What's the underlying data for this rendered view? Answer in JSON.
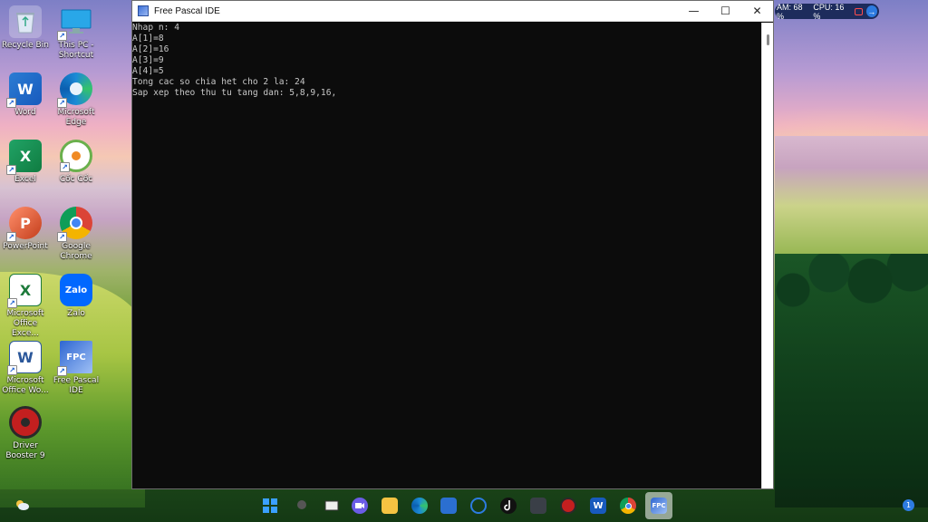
{
  "window": {
    "title": "Free Pascal IDE",
    "minimize_glyph": "—",
    "maximize_glyph": "☐",
    "close_glyph": "✕"
  },
  "console": {
    "lines": [
      "Nhap n: 4",
      "A[1]=8",
      "A[2]=16",
      "A[3]=9",
      "A[4]=5",
      "Tong cac so chia het cho 2 la: 24",
      "Sap xep theo thu tu tang dan: 5,8,9,16,"
    ]
  },
  "desktop": {
    "icons": [
      {
        "label": "Recycle Bin",
        "icon": "recycle-bin-icon"
      },
      {
        "label": "This PC - Shortcut",
        "icon": "monitor-icon"
      },
      {
        "label": "Word",
        "icon": "word-icon"
      },
      {
        "label": "Microsoft Edge",
        "icon": "edge-icon"
      },
      {
        "label": "Excel",
        "icon": "excel-icon"
      },
      {
        "label": "Cốc Cốc",
        "icon": "coccoc-icon"
      },
      {
        "label": "PowerPoint",
        "icon": "powerpoint-icon"
      },
      {
        "label": "Google Chrome",
        "icon": "chrome-icon"
      },
      {
        "label": "Microsoft Office Exce...",
        "icon": "office-excel-icon"
      },
      {
        "label": "Zalo",
        "icon": "zalo-icon"
      },
      {
        "label": "Microsoft Office Wo...",
        "icon": "office-word-icon"
      },
      {
        "label": "Free Pascal IDE",
        "icon": "fpc-icon"
      },
      {
        "label": "Driver Booster 9",
        "icon": "driver-booster-icon"
      }
    ],
    "zalo_glyph": "Zalo",
    "fpc_glyph": "FPC",
    "letters": {
      "word": "W",
      "excel": "X",
      "powerpoint": "P"
    }
  },
  "perf_widget": {
    "ram": "AM: 68 %",
    "cpu": "CPU: 16 %",
    "arrow": "→"
  },
  "taskbar": {
    "icons": [
      "windows-start-icon",
      "search-icon",
      "task-view-icon",
      "teams-icon",
      "file-explorer-icon",
      "edge-icon",
      "store-icon",
      "cortana-icon",
      "tiktok-icon",
      "installer-icon",
      "driver-booster-icon",
      "word-icon",
      "chrome-icon",
      "fpc-icon"
    ],
    "notification_count": "1"
  },
  "colors": {
    "console_bg": "#0c0c0c",
    "console_text": "#c8c8c8",
    "taskbar_active": "#d9d9d9",
    "accent": "#2d7be0"
  }
}
